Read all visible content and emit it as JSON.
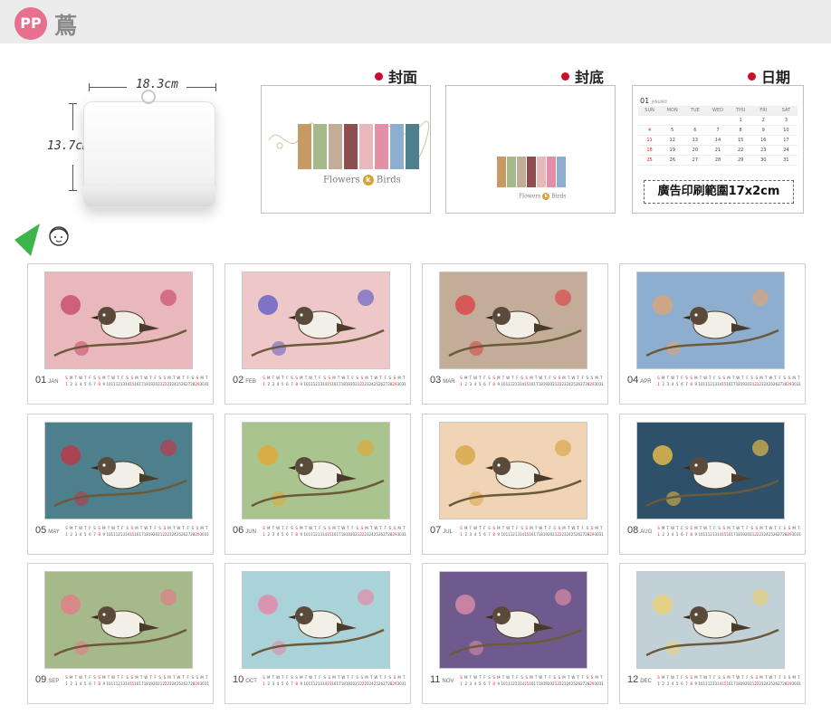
{
  "header": {
    "badge": "PP",
    "title": "蔦"
  },
  "product": {
    "width_label": "18.3cm",
    "height_label": "13.7cm"
  },
  "sections": {
    "cover": "封面",
    "back": "封底",
    "date": "日期"
  },
  "cover_brand": {
    "left": "Flowers",
    "right": "Birds",
    "badge": "k"
  },
  "date_sample": {
    "month_label": "01",
    "month_name": "JANUARY",
    "weekdays": [
      "SUN",
      "MON",
      "TUE",
      "WED",
      "THU",
      "FRI",
      "SAT"
    ],
    "weeks": [
      [
        "",
        "",
        "",
        "",
        "1",
        "2",
        "3"
      ],
      [
        "4",
        "5",
        "6",
        "7",
        "8",
        "9",
        "10"
      ],
      [
        "11",
        "12",
        "13",
        "14",
        "15",
        "16",
        "17"
      ],
      [
        "18",
        "19",
        "20",
        "21",
        "22",
        "23",
        "24"
      ],
      [
        "25",
        "26",
        "27",
        "28",
        "29",
        "30",
        "31"
      ]
    ],
    "ad_text": "廣告印刷範圍17x2cm"
  },
  "months": [
    {
      "num": "01",
      "name": "JAN"
    },
    {
      "num": "02",
      "name": "FEB"
    },
    {
      "num": "03",
      "name": "MAR"
    },
    {
      "num": "04",
      "name": "APR"
    },
    {
      "num": "05",
      "name": "MAY"
    },
    {
      "num": "06",
      "name": "JUN"
    },
    {
      "num": "07",
      "name": "JUL"
    },
    {
      "num": "08",
      "name": "AUG"
    },
    {
      "num": "09",
      "name": "SEP"
    },
    {
      "num": "10",
      "name": "OCT"
    },
    {
      "num": "11",
      "name": "NOV"
    },
    {
      "num": "12",
      "name": "DEC"
    }
  ],
  "colors": {
    "badge": "#e8708f",
    "accent_dot": "#c8102e",
    "art_backgrounds": [
      "#e9b8bc",
      "#eec8c8",
      "#c4ad98",
      "#8eaed0",
      "#4e7f8c",
      "#a9c48e",
      "#f1d4b6",
      "#2e5068",
      "#a6b98a",
      "#a9d3d8",
      "#6f5a8e",
      "#c2d1d8"
    ]
  }
}
